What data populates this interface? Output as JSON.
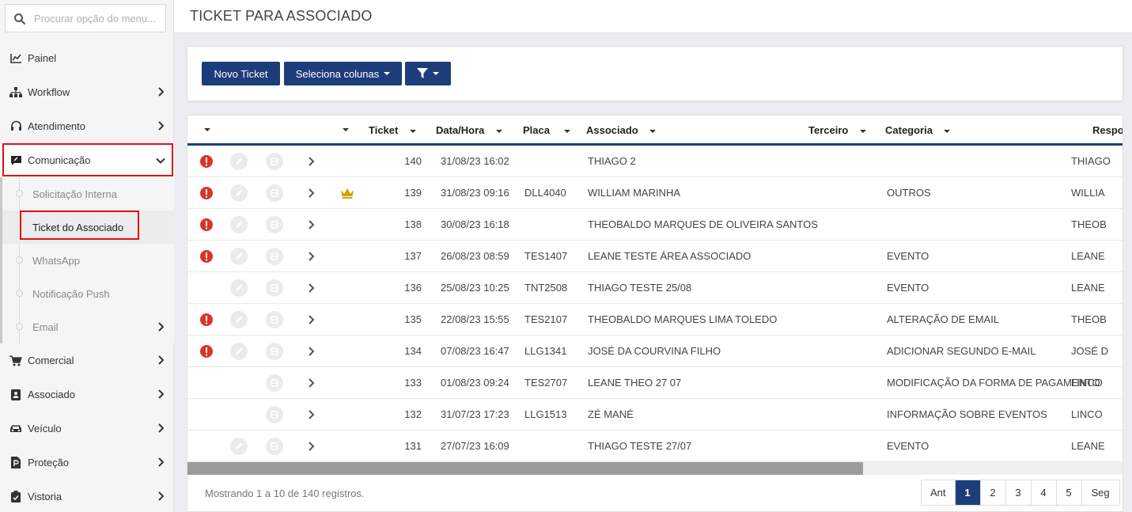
{
  "sidebar": {
    "search_placeholder": "Procurar opção do menu...",
    "items": [
      {
        "label": "Painel",
        "icon": "chart-icon"
      },
      {
        "label": "Workflow",
        "icon": "sitemap-icon"
      },
      {
        "label": "Atendimento",
        "icon": "headset-icon"
      },
      {
        "label": "Comunicação",
        "icon": "comment-icon"
      },
      {
        "label": "Comercial",
        "icon": "cart-icon"
      },
      {
        "label": "Associado",
        "icon": "id-badge-icon"
      },
      {
        "label": "Veículo",
        "icon": "car-icon"
      },
      {
        "label": "Proteção",
        "icon": "parking-icon"
      },
      {
        "label": "Vistoria",
        "icon": "clipboard-check-icon"
      }
    ],
    "submenu": [
      {
        "label": "Solicitação Interna"
      },
      {
        "label": "Ticket do Associado"
      },
      {
        "label": "WhatsApp"
      },
      {
        "label": "Notificação Push"
      },
      {
        "label": "Email"
      }
    ]
  },
  "header": {
    "title": "TICKET PARA ASSOCIADO"
  },
  "toolbar": {
    "new_ticket": "Novo Ticket",
    "select_columns": "Seleciona colunas"
  },
  "table": {
    "columns": {
      "ticket": "Ticket",
      "date": "Data/Hora",
      "plate": "Placa",
      "member": "Associado",
      "third": "Terceiro",
      "category": "Categoria",
      "responsible": "Respo"
    },
    "rows": [
      {
        "alert": true,
        "edit": true,
        "crown": false,
        "ticket": "140",
        "date": "31/08/23 16:02",
        "plate": "",
        "member": "THIAGO 2",
        "category": "",
        "responsible": "THIAGO"
      },
      {
        "alert": true,
        "edit": true,
        "crown": true,
        "ticket": "139",
        "date": "31/08/23 09:16",
        "plate": "DLL4040",
        "member": "WILLIAM MARINHA",
        "category": "OUTROS",
        "responsible": "WILLIA"
      },
      {
        "alert": true,
        "edit": true,
        "crown": false,
        "ticket": "138",
        "date": "30/08/23 16:18",
        "plate": "",
        "member": "THEOBALDO MARQUES DE OLIVEIRA SANTOS",
        "category": "",
        "responsible": "THEOB"
      },
      {
        "alert": true,
        "edit": true,
        "crown": false,
        "ticket": "137",
        "date": "26/08/23 08:59",
        "plate": "TES1407",
        "member": "LEANE TESTE ÁREA ASSOCIADO",
        "category": "EVENTO",
        "responsible": "LEANE"
      },
      {
        "alert": false,
        "edit": true,
        "crown": false,
        "ticket": "136",
        "date": "25/08/23 10:25",
        "plate": "TNT2508",
        "member": "THIAGO TESTE 25/08",
        "category": "EVENTO",
        "responsible": "LEANE"
      },
      {
        "alert": true,
        "edit": true,
        "crown": false,
        "ticket": "135",
        "date": "22/08/23 15:55",
        "plate": "TES2107",
        "member": "THEOBALDO MARQUES LIMA TOLEDO",
        "category": "ALTERAÇÃO DE EMAIL",
        "responsible": "THEOB"
      },
      {
        "alert": true,
        "edit": true,
        "crown": false,
        "ticket": "134",
        "date": "07/08/23 16:47",
        "plate": "LLG1341",
        "member": "JOSÉ DA COURVINA FILHO",
        "category": "ADICIONAR SEGUNDO E-MAIL",
        "responsible": "JOSÉ D"
      },
      {
        "alert": false,
        "edit": false,
        "crown": false,
        "ticket": "133",
        "date": "01/08/23 09:24",
        "plate": "TES2707",
        "member": "LEANE THEO 27 07",
        "category": "MODIFICAÇÃO DA FORMA DE PAGAMENTO",
        "responsible": "LINCO"
      },
      {
        "alert": false,
        "edit": false,
        "crown": false,
        "ticket": "132",
        "date": "31/07/23 17:23",
        "plate": "LLG1513",
        "member": "ZÉ MANÉ",
        "category": "INFORMAÇÃO SOBRE EVENTOS",
        "responsible": "LINCO"
      },
      {
        "alert": false,
        "edit": true,
        "crown": false,
        "ticket": "131",
        "date": "27/07/23 16:09",
        "plate": "",
        "member": "THIAGO TESTE 27/07",
        "category": "EVENTO",
        "responsible": "LEANE"
      }
    ]
  },
  "footer": {
    "info": "Mostrando 1 a 10 de 140 registros."
  },
  "pagination": {
    "prev": "Ant",
    "pages": [
      "1",
      "2",
      "3",
      "4",
      "5"
    ],
    "next": "Seg",
    "current": "1"
  },
  "colors": {
    "primary": "#1d3d7a",
    "alert": "#d9342b",
    "highlight": "#e01010",
    "crown": "#c9a400"
  }
}
